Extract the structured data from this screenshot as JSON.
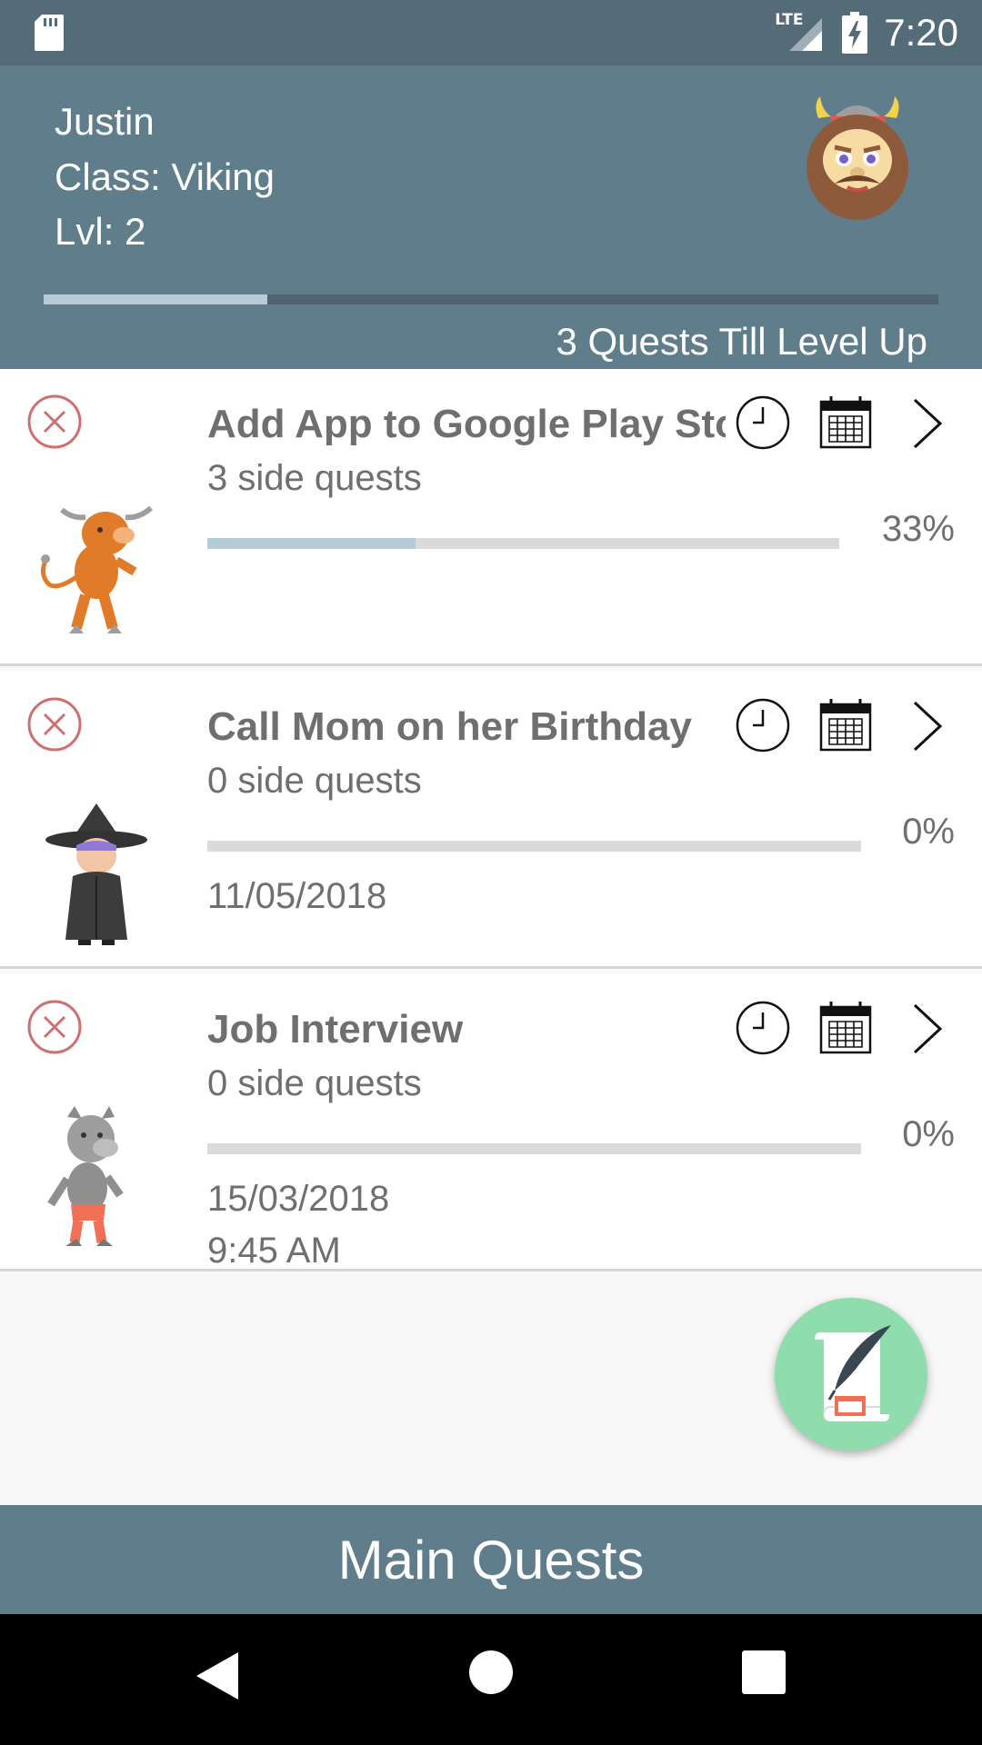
{
  "status_bar": {
    "network": "LTE",
    "time": "7:20",
    "icons": [
      "sd-card-icon",
      "lte-signal-icon",
      "battery-charging-icon"
    ]
  },
  "profile": {
    "name": "Justin",
    "class_label": "Class: Viking",
    "level_label": "Lvl: 2",
    "avatar": "viking-avatar",
    "xp_progress": 0.25,
    "xp_caption": "3 Quests Till Level Up",
    "colors": {
      "header": "#607d8b",
      "xp_fill": "#b6cdd8",
      "xp_track": "#4e6470"
    }
  },
  "quests": [
    {
      "title": "Add App to Google Play Stor",
      "side_quests": "3 side quests",
      "percent_label": "33%",
      "progress": 0.33,
      "date": "",
      "time": "",
      "monster": "minotaur-icon"
    },
    {
      "title": "Call Mom on her Birthday",
      "side_quests": "0 side quests",
      "percent_label": "0%",
      "progress": 0,
      "date": "11/05/2018",
      "time": "",
      "monster": "witch-icon"
    },
    {
      "title": "Job Interview",
      "side_quests": "0 side quests",
      "percent_label": "0%",
      "progress": 0,
      "date": "15/03/2018",
      "time": "9:45 AM",
      "monster": "werewolf-icon"
    }
  ],
  "fab": {
    "icon": "scroll-quill-icon",
    "color": "#8fddad"
  },
  "bottom_bar": {
    "label": "Main Quests"
  },
  "nav": {
    "icons": [
      "back-icon",
      "home-icon",
      "recents-icon"
    ]
  }
}
